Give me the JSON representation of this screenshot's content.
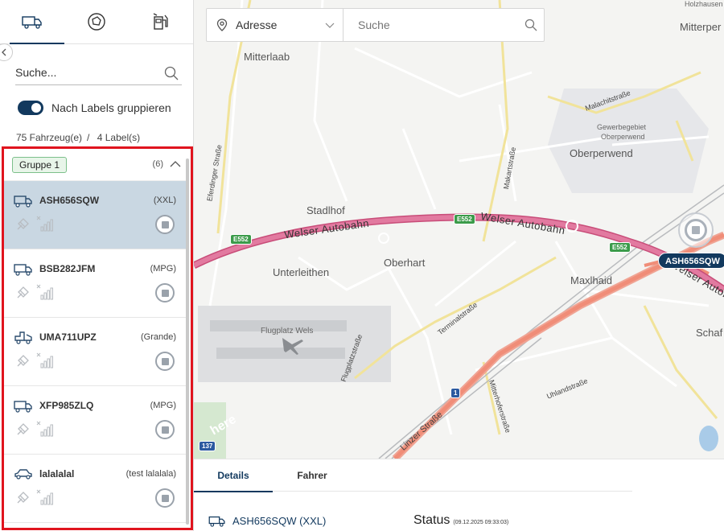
{
  "sidebar": {
    "tabs": [
      {
        "icon": "truck-icon"
      },
      {
        "icon": "geofence-icon"
      },
      {
        "icon": "fuel-pump-icon"
      }
    ],
    "search_placeholder": "Suche...",
    "group_toggle_label": "Nach Labels gruppieren",
    "vehicle_count": "75 Fahrzeug(e)",
    "separator": "/",
    "label_count": "4 Label(s)",
    "group": {
      "name": "Gruppe 1",
      "count": "(6)"
    },
    "vehicles": [
      {
        "plate": "ASH656SQW",
        "type": "(XXL)",
        "icon": "truck-icon",
        "selected": true
      },
      {
        "plate": "BSB282JFM",
        "type": "(MPG)",
        "icon": "truck-icon",
        "selected": false
      },
      {
        "plate": "UMA711UPZ",
        "type": "(Grande)",
        "icon": "tow-truck-icon",
        "selected": false
      },
      {
        "plate": "XFP985ZLQ",
        "type": "(MPG)",
        "icon": "truck-icon",
        "selected": false
      },
      {
        "plate": "lalalalal",
        "type": "(test lalalala)",
        "icon": "car-icon",
        "selected": false
      }
    ]
  },
  "map_search": {
    "address_select": "Adresse",
    "search_placeholder": "Suche"
  },
  "map": {
    "places": {
      "mitterlaab": "Mitterlaab",
      "stadlhof": "Stadlhof",
      "unterleithen": "Unterleithen",
      "oberhart": "Oberhart",
      "oberperwend": "Oberperwend",
      "maxlhaid": "Maxlhaid",
      "gewerbegebiet": "Gewerbegebiet",
      "gewerbegebiet2": "Oberperwend",
      "flugplatz": "Flugplatz Wels",
      "holzhausen": "Holzhausen",
      "mitterper": "Mitterper",
      "schaf": "Schaf"
    },
    "streets": {
      "eferdinger": "Eferdinger Straße",
      "malachit": "Malachitstraße",
      "makart": "Makartstraße",
      "terminal": "Terminalstraße",
      "flugplatzstr": "Flugplatzstraße",
      "linzer": "Linzer Straße",
      "mitterhofer": "Mitterhoferstraße",
      "uhland": "Uhlandstraße"
    },
    "highway": "Welser Autobahn",
    "highway2": "Welser Autobahn",
    "highway3": "Welser Autob",
    "shields": {
      "e552_a": "E552",
      "e552_b": "E552",
      "e552_c": "E552",
      "one": "1",
      "b137": "137"
    },
    "watermark": "here",
    "vehicle_marker": "ASH656SQW"
  },
  "detail": {
    "tabs": [
      "Details",
      "Fahrer"
    ],
    "vehicle": "ASH656SQW (XXL)",
    "status_title": "Status",
    "status_time": "(09.12.2025 09:33:03)"
  },
  "colors": {
    "primary": "#12395e",
    "selected_row": "#c9d7e2",
    "highlight_border": "#e0141e",
    "motorway": "#d9628e",
    "main_road": "#f08d78"
  }
}
